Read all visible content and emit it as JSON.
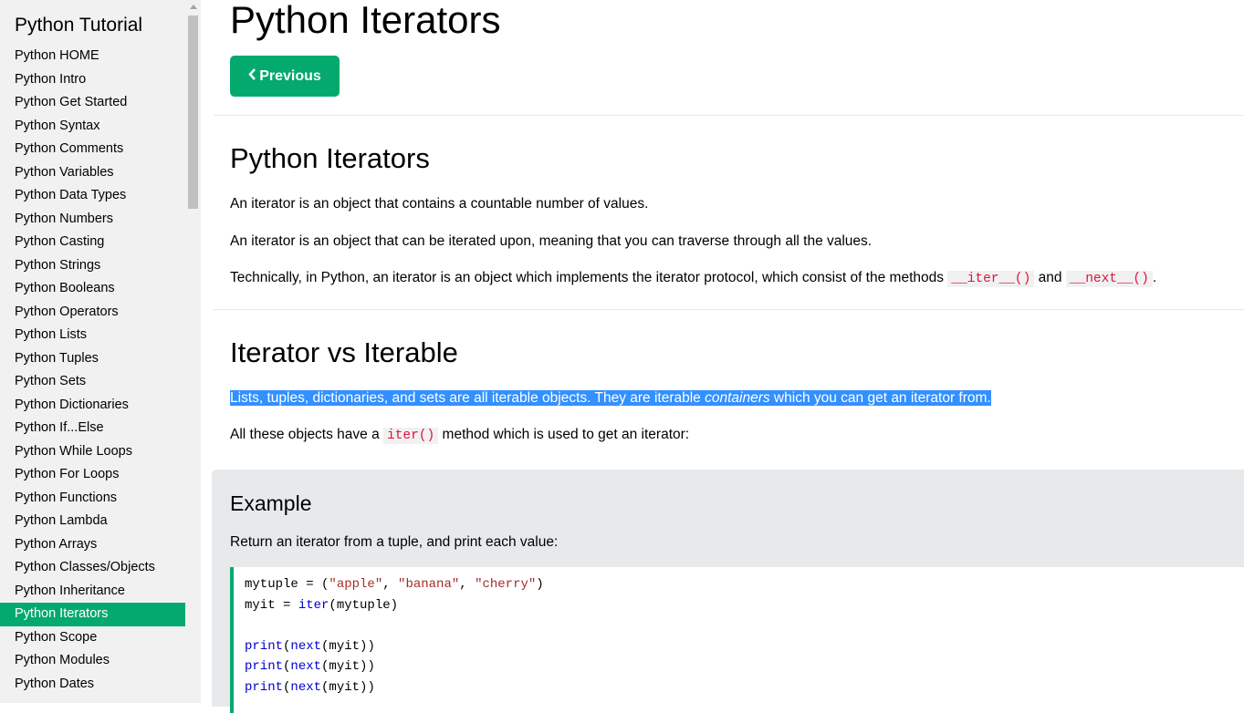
{
  "sidebar": {
    "title": "Python Tutorial",
    "items": [
      {
        "label": "Python HOME",
        "active": false
      },
      {
        "label": "Python Intro",
        "active": false
      },
      {
        "label": "Python Get Started",
        "active": false
      },
      {
        "label": "Python Syntax",
        "active": false
      },
      {
        "label": "Python Comments",
        "active": false
      },
      {
        "label": "Python Variables",
        "active": false
      },
      {
        "label": "Python Data Types",
        "active": false
      },
      {
        "label": "Python Numbers",
        "active": false
      },
      {
        "label": "Python Casting",
        "active": false
      },
      {
        "label": "Python Strings",
        "active": false
      },
      {
        "label": "Python Booleans",
        "active": false
      },
      {
        "label": "Python Operators",
        "active": false
      },
      {
        "label": "Python Lists",
        "active": false
      },
      {
        "label": "Python Tuples",
        "active": false
      },
      {
        "label": "Python Sets",
        "active": false
      },
      {
        "label": "Python Dictionaries",
        "active": false
      },
      {
        "label": "Python If...Else",
        "active": false
      },
      {
        "label": "Python While Loops",
        "active": false
      },
      {
        "label": "Python For Loops",
        "active": false
      },
      {
        "label": "Python Functions",
        "active": false
      },
      {
        "label": "Python Lambda",
        "active": false
      },
      {
        "label": "Python Arrays",
        "active": false
      },
      {
        "label": "Python Classes/Objects",
        "active": false
      },
      {
        "label": "Python Inheritance",
        "active": false
      },
      {
        "label": "Python Iterators",
        "active": true
      },
      {
        "label": "Python Scope",
        "active": false
      },
      {
        "label": "Python Modules",
        "active": false
      },
      {
        "label": "Python Dates",
        "active": false
      }
    ]
  },
  "main": {
    "page_title": "Python Iterators",
    "previous_label": "Previous",
    "section1": {
      "heading": "Python Iterators",
      "p1": "An iterator is an object that contains a countable number of values.",
      "p2": "An iterator is an object that can be iterated upon, meaning that you can traverse through all the values.",
      "p3_before": "Technically, in Python, an iterator is an object which implements the iterator protocol, which consist of the methods ",
      "p3_code1": "__iter__()",
      "p3_mid": " and ",
      "p3_code2": "__next__()",
      "p3_after": "."
    },
    "section2": {
      "heading": "Iterator vs Iterable",
      "p1_before": "Lists, tuples, dictionaries, and sets are all iterable objects. They are iterable ",
      "p1_em": "containers",
      "p1_after": " which you can get an iterator from.",
      "p2_before": "All these objects have a ",
      "p2_code": "iter()",
      "p2_after": " method which is used to get an iterator:"
    },
    "example": {
      "heading": "Example",
      "desc": "Return an iterator from a tuple, and print each value:",
      "code": {
        "l1_a": "mytuple = (",
        "l1_s1": "\"apple\"",
        "l1_c1": ", ",
        "l1_s2": "\"banana\"",
        "l1_c2": ", ",
        "l1_s3": "\"cherry\"",
        "l1_end": ")",
        "l2_a": "myit = ",
        "l2_fn": "iter",
        "l2_end": "(mytuple)",
        "print_fn": "print",
        "next_fn": "next",
        "p_open": "(",
        "p_args": "(myit))"
      }
    }
  },
  "colors": {
    "accent": "#04aa6d",
    "selection": "#3390ff",
    "inline_code": "#dc143c",
    "code_string": "#a52a2a",
    "code_function": "#0000cd"
  }
}
